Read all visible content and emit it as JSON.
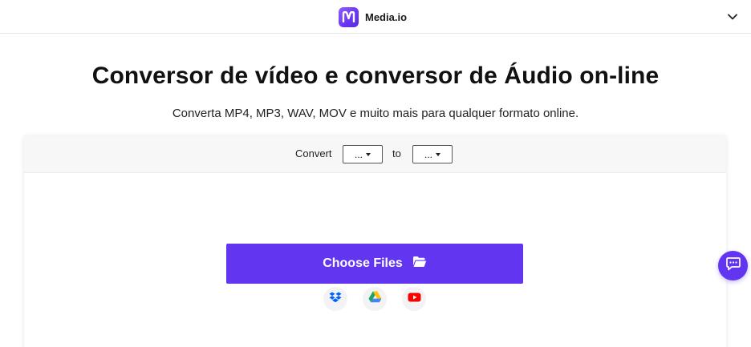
{
  "header": {
    "brand_name": "Media.io",
    "logo_icon": "media-io-logo-icon",
    "menu_icon": "chevron-down-icon"
  },
  "hero": {
    "title": "Conversor de vídeo e conversor de Áudio on-line",
    "subtitle": "Converta MP4, MP3, WAV, MOV e muito mais para qualquer formato online."
  },
  "converter": {
    "convert_label": "Convert",
    "from_format": "...",
    "to_label": "to",
    "to_format": "...",
    "choose_files_label": "Choose Files",
    "choose_files_icon": "folder-open-icon",
    "sources": [
      {
        "name": "dropbox",
        "icon": "dropbox-icon",
        "color": "#0061fe"
      },
      {
        "name": "google-drive",
        "icon": "google-drive-icon",
        "color": "#1fa463"
      },
      {
        "name": "youtube",
        "icon": "youtube-icon",
        "color": "#ff0000"
      }
    ]
  },
  "chat": {
    "icon": "chat-icon"
  },
  "colors": {
    "accent": "#6236f0",
    "logo_gradient_start": "#8f5cff",
    "card_bar_bg": "#f7f7f7"
  }
}
